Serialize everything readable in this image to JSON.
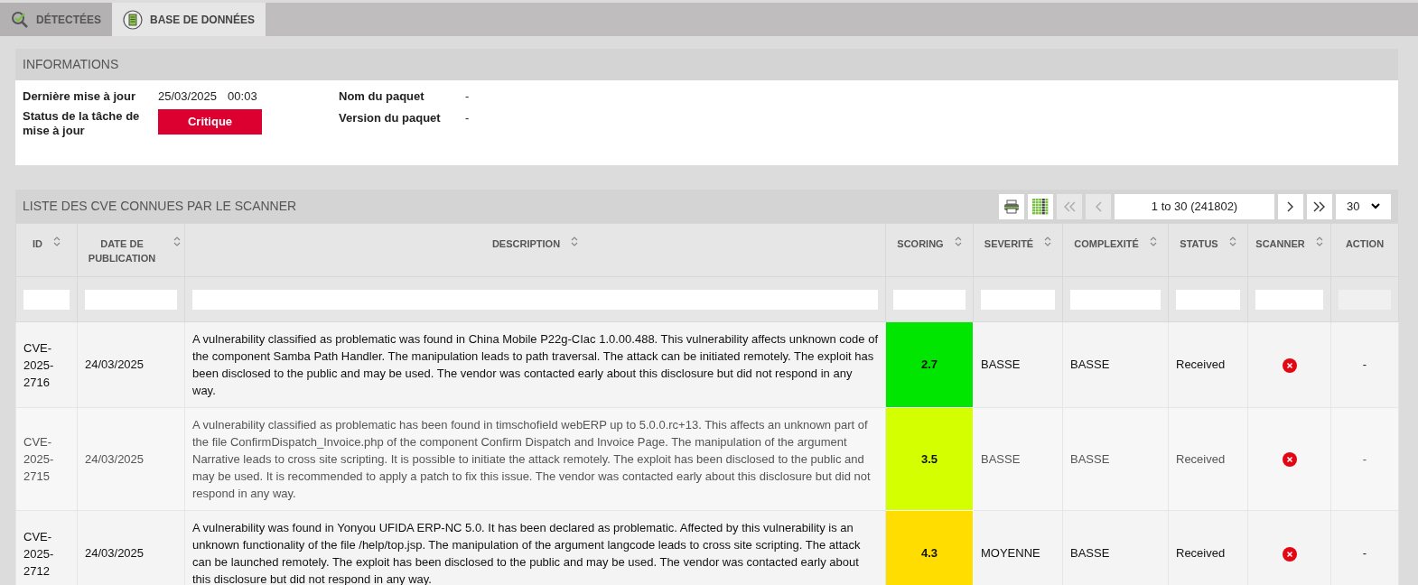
{
  "tabs": [
    {
      "label": "DÉTECTÉES",
      "selected": false
    },
    {
      "label": "BASE DE DONNÉES",
      "selected": true
    }
  ],
  "informations": {
    "title": "INFORMATIONS",
    "last_update_label": "Dernière mise à jour",
    "last_update_date": "25/03/2025",
    "last_update_time": "00:03",
    "task_status_label": "Status de la tâche de mise à jour",
    "task_status": "Critique",
    "package_name_label": "Nom du paquet",
    "package_name": "-",
    "package_version_label": "Version du paquet",
    "package_version": "-"
  },
  "cve_list": {
    "title": "LISTE DES CVE CONNUES PAR LE SCANNER",
    "pagination": {
      "range": "1 to 30 (241802)",
      "page_size": "30"
    },
    "columns": [
      {
        "label": "ID",
        "sortable": true
      },
      {
        "label": "DATE DE PUBLICATION",
        "sortable": true
      },
      {
        "label": "DESCRIPTION",
        "sortable": true
      },
      {
        "label": "SCORING",
        "sortable": true
      },
      {
        "label": "SEVERITÉ",
        "sortable": true
      },
      {
        "label": "COMPLEXITÉ",
        "sortable": true
      },
      {
        "label": "STATUS",
        "sortable": true
      },
      {
        "label": "SCANNER",
        "sortable": true
      },
      {
        "label": "ACTION",
        "sortable": false
      }
    ],
    "rows": [
      {
        "id": "CVE-2025-2716",
        "date": "24/03/2025",
        "description": "A vulnerability classified as problematic was found in China Mobile P22g-CIac 1.0.00.488. This vulnerability affects unknown code of the component Samba Path Handler. The manipulation leads to path traversal. The attack can be initiated remotely. The exploit has been disclosed to the public and may be used. The vendor was contacted early about this disclosure but did not respond in any way.",
        "scoring": "2.7",
        "color": "#00e600",
        "severity": "BASSE",
        "complexity": "BASSE",
        "status": "Received",
        "action": "-",
        "dimmed": false
      },
      {
        "id": "CVE-2025-2715",
        "date": "24/03/2025",
        "description": "A vulnerability classified as problematic has been found in timschofield webERP up to 5.0.0.rc+13. This affects an unknown part of the file ConfirmDispatch_Invoice.php of the component Confirm Dispatch and Invoice Page. The manipulation of the argument Narrative leads to cross site scripting. It is possible to initiate the attack remotely. The exploit has been disclosed to the public and may be used. It is recommended to apply a patch to fix this issue. The vendor was contacted early about this disclosure but did not respond in any way.",
        "scoring": "3.5",
        "color": "#d4ff00",
        "severity": "BASSE",
        "complexity": "BASSE",
        "status": "Received",
        "action": "-",
        "dimmed": true
      },
      {
        "id": "CVE-2025-2712",
        "date": "24/03/2025",
        "description": "A vulnerability was found in Yonyou UFIDA ERP-NC 5.0. It has been declared as problematic. Affected by this vulnerability is an unknown functionality of the file /help/top.jsp. The manipulation of the argument langcode leads to cross site scripting. The attack can be launched remotely. The exploit has been disclosed to the public and may be used. The vendor was contacted early about this disclosure but did not respond in any way.",
        "scoring": "4.3",
        "color": "#ffdd00",
        "severity": "MOYENNE",
        "complexity": "BASSE",
        "status": "Received",
        "action": "-",
        "dimmed": false
      }
    ]
  }
}
